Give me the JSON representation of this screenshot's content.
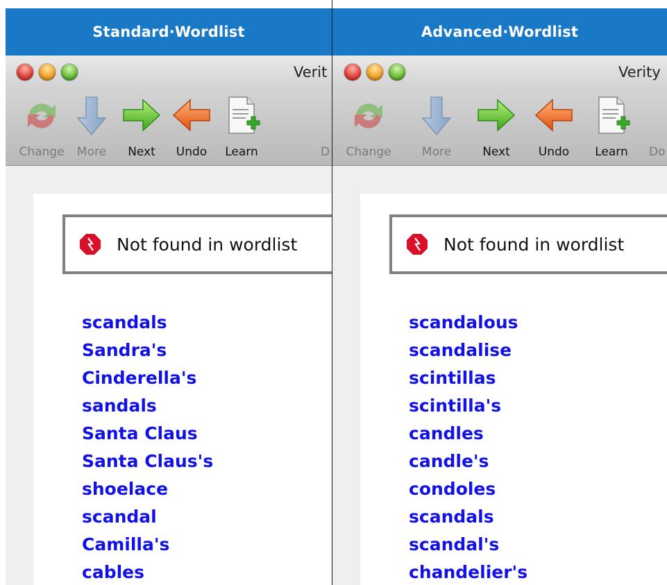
{
  "panels": [
    {
      "banner": "Standard·Wordlist",
      "window_title": "Verit",
      "toolbar": [
        {
          "label": "Change",
          "icon": "change-icon",
          "enabled": false
        },
        {
          "label": "More",
          "icon": "down-arrow-icon",
          "enabled": false
        },
        {
          "label": "Next",
          "icon": "right-arrow-icon",
          "enabled": true
        },
        {
          "label": "Undo",
          "icon": "left-arrow-icon",
          "enabled": true
        },
        {
          "label": "Learn",
          "icon": "learn-document-icon",
          "enabled": true
        },
        {
          "label": "D",
          "icon": "truncated-icon",
          "enabled": false
        }
      ],
      "alert": {
        "icon": "stop-sign-icon",
        "message": "Not found in wordlist"
      },
      "suggestions": [
        "scandals",
        "Sandra's",
        "Cinderella's",
        "sandals",
        "Santa Claus",
        "Santa Claus's",
        "shoelace",
        "scandal",
        "Camilla's",
        "cables"
      ]
    },
    {
      "banner": "Advanced·Wordlist",
      "window_title": "Verity",
      "toolbar": [
        {
          "label": "Change",
          "icon": "change-icon",
          "enabled": false
        },
        {
          "label": "More",
          "icon": "down-arrow-icon",
          "enabled": false
        },
        {
          "label": "Next",
          "icon": "right-arrow-icon",
          "enabled": true
        },
        {
          "label": "Undo",
          "icon": "left-arrow-icon",
          "enabled": true
        },
        {
          "label": "Learn",
          "icon": "learn-document-icon",
          "enabled": true
        },
        {
          "label": "Do",
          "icon": "truncated-icon",
          "enabled": false
        }
      ],
      "alert": {
        "icon": "stop-sign-icon",
        "message": "Not found in wordlist"
      },
      "suggestions": [
        "scandalous",
        "scandalise",
        "scintillas",
        "scintilla's",
        "candles",
        "candle's",
        "condoles",
        "scandals",
        "scandal's",
        "chandelier's"
      ]
    }
  ],
  "colors": {
    "banner": "#1a79c6",
    "suggestion": "#1212e6",
    "alert_border": "#808080"
  }
}
